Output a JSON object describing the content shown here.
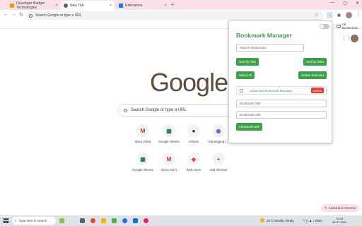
{
  "tabs": [
    {
      "label": "Developer Badger Technologies"
    },
    {
      "label": "New Tab"
    },
    {
      "label": "Extensions"
    }
  ],
  "omnibox": {
    "placeholder": "Search Google or type a URL"
  },
  "bookmarks_bar": {
    "all_bookmarks": "All Bookmarks"
  },
  "ntp": {
    "logo": "Google",
    "search_placeholder": "Search Google or type a URL",
    "shortcuts": [
      {
        "label": "Inbox (553)",
        "icon": "gmail-icon",
        "glyph": "M",
        "color": "#d93025"
      },
      {
        "label": "Google Sheets",
        "icon": "sheets-icon",
        "glyph": "▦",
        "color": "#188038"
      },
      {
        "label": "GitHub",
        "icon": "github-icon",
        "glyph": "●",
        "color": "#24292f"
      },
      {
        "label": "Izamargjing (...",
        "icon": "site-icon",
        "glyph": "◉",
        "color": "#7e57c2"
      },
      {
        "label": "Google Sheets",
        "icon": "sheets-icon",
        "glyph": "▦",
        "color": "#188038"
      },
      {
        "label": "Inbox (317)",
        "icon": "gmail-icon",
        "glyph": "M",
        "color": "#d93025"
      },
      {
        "label": "Web Store",
        "icon": "webstore-icon",
        "glyph": "◆",
        "color": "#ea4335"
      },
      {
        "label": "Add shortcut",
        "icon": "plus-icon",
        "glyph": "+",
        "color": "#5f6368"
      }
    ],
    "customize": "Customize Chrome"
  },
  "popup": {
    "title": "Bookmark Manager",
    "search_placeholder": "Search bookmarks",
    "sort_title": "Sort by Title",
    "sort_date": "Sort by Date",
    "select_all": "Select All",
    "delete_selected": "Delete Selected",
    "bookmark_item": "Advanced Bookmark Manager",
    "delete": "Delete",
    "title_placeholder": "Bookmark Title",
    "url_placeholder": "Bookmark URL",
    "add": "Add Bookmark"
  },
  "taskbar": {
    "search": "Type here to search",
    "weather": "25°C  Mostly cloudy",
    "lang": "ENG",
    "time": "15:41",
    "date": "28-07-2024"
  },
  "colors": {
    "accent_green": "#3fa04b",
    "delete_red": "#e53935",
    "tabstrip": "#f9e1e7"
  }
}
